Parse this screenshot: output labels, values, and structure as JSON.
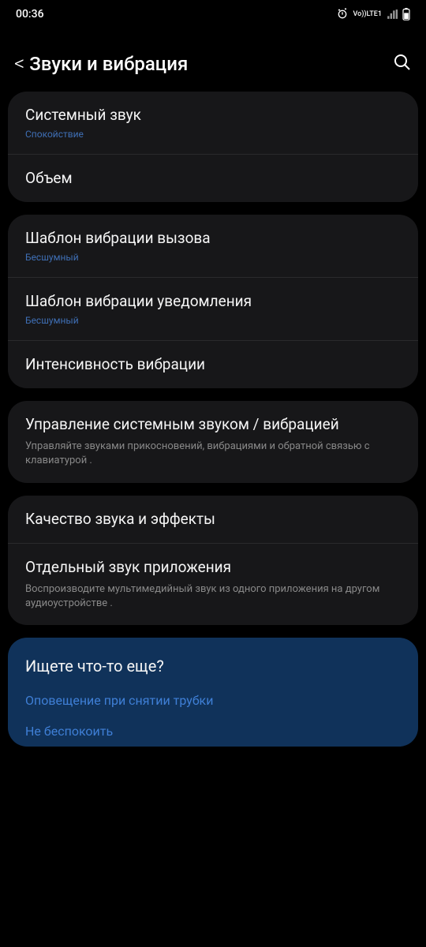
{
  "status": {
    "time": "00:36",
    "vo": "Vo))",
    "lte": "LTE1"
  },
  "header": {
    "back": "<",
    "title": "Звуки и вибрация"
  },
  "groups": {
    "g1": {
      "system_sound": {
        "title": "Системный звук",
        "sub": "Спокойствие"
      },
      "volume": {
        "title": "Объем"
      }
    },
    "g2": {
      "call_vib": {
        "title": "Шаблон вибрации вызова",
        "sub": "Бесшумный"
      },
      "notif_vib": {
        "title": "Шаблон вибрации уведомления",
        "sub": "Бесшумный"
      },
      "vib_intensity": {
        "title": "Интенсивность вибрации"
      }
    },
    "g3": {
      "sys_control": {
        "title": "Управление системным звуком / вибрацией",
        "desc": "Управляйте звуками прикосновений, вибрациями и обратной связью с клавиатурой ."
      }
    },
    "g4": {
      "quality": {
        "title": "Качество звука и эффекты"
      },
      "app_sound": {
        "title": "Отдельный звук приложения",
        "desc": "Воспроизводите мультимедийный звук из одного приложения на другом аудиоустройстве ."
      }
    },
    "suggest": {
      "title": "Ищете что-то еще?",
      "link1": "Оповещение при снятии трубки",
      "link2": "Не беспокоить"
    }
  }
}
